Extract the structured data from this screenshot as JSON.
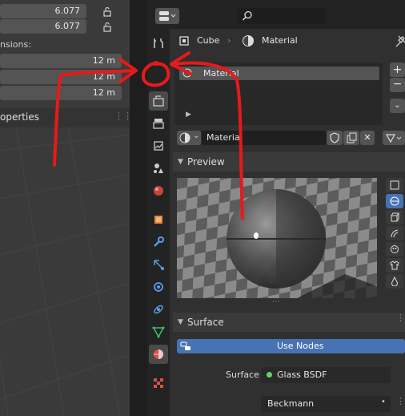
{
  "left_panel": {
    "fields": [
      {
        "value": "6.077"
      },
      {
        "value": "6.077"
      }
    ],
    "dimensions_label": "nsions:",
    "dimensions": [
      "12 m",
      "12 m",
      "12 m"
    ],
    "section_title": "operties"
  },
  "header": {
    "editor_type_icon": "editor-type-icon",
    "search_icon": "search-icon"
  },
  "breadcrumb": {
    "object": "Cube",
    "material": "Material"
  },
  "slots": {
    "items": [
      "Material"
    ]
  },
  "material_selector": {
    "name": "Material"
  },
  "preview": {
    "title": "Preview"
  },
  "surface": {
    "title": "Surface",
    "use_nodes_label": "Use Nodes",
    "surface_label": "Surface",
    "shader_value": "Glass BSDF",
    "distribution_value": "Beckmann"
  },
  "colors": {
    "accent_blue": "#4772b3",
    "annotation_red": "#e8191b",
    "shader_dot": "#6ccf6c"
  }
}
